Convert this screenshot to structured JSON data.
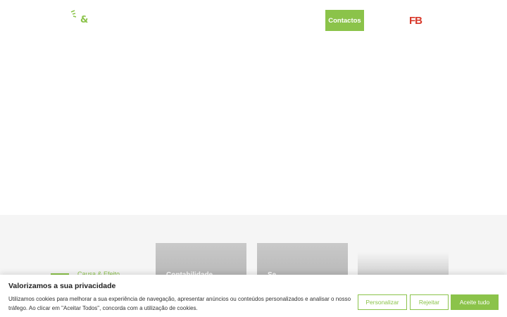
{
  "header": {
    "logo_amp": "&",
    "contact_label": "Contactos",
    "partner_logo": "FB"
  },
  "colors": {
    "accent": "#8bc34a",
    "partner": "#d8392b"
  },
  "section": {
    "brand_text": "Causa & Efeito",
    "cards": [
      {
        "title": "Contabilidade"
      },
      {
        "title": "Se..."
      },
      {
        "title": ""
      }
    ]
  },
  "cookie": {
    "title": "Valorizamos a sua privacidade",
    "text": "Utilizamos cookies para melhorar a sua experiência de navegação, apresentar anúncios ou conteúdos personalizados e analisar o nosso tráfego. Ao clicar em \"Aceitar Todos\", concorda com a utilização de cookies.",
    "customize_label": "Personalizar",
    "reject_label": "Rejeitar",
    "accept_label": "Aceite tudo"
  }
}
